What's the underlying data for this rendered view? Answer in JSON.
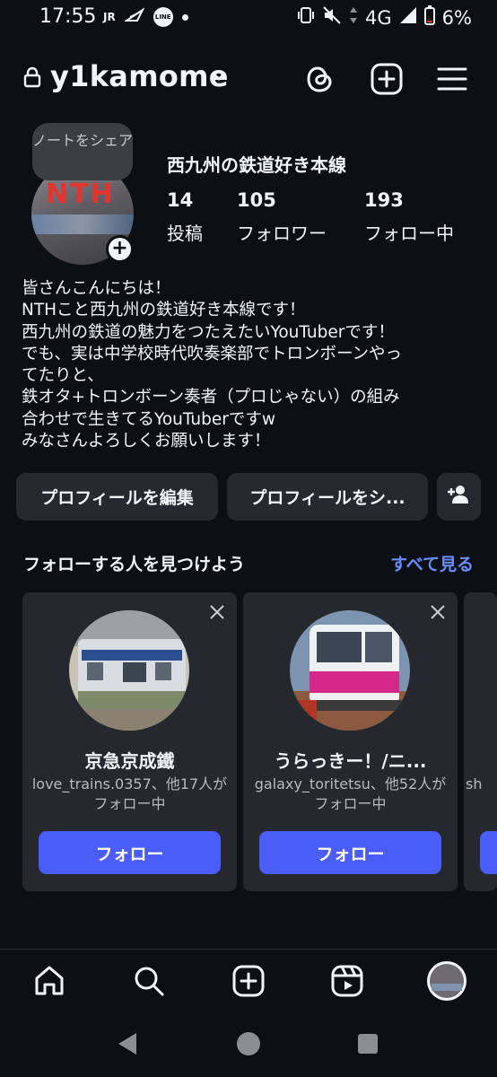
{
  "status_bar": {
    "time": "17:55",
    "jr_label": "JR",
    "line_label": "LINE",
    "network": "4G",
    "battery": "6%"
  },
  "header": {
    "username": "y1kamome",
    "icons": [
      "lock-icon",
      "chevron-down-icon",
      "threads-icon",
      "create-post-icon",
      "menu-icon"
    ]
  },
  "profile": {
    "note_prompt": "ノートをシェア",
    "avatar_text": "NTH",
    "display_name": "西九州の鉄道好き本線",
    "stats": [
      {
        "value": "14",
        "label": "投稿"
      },
      {
        "value": "105",
        "label": "フォロワー"
      },
      {
        "value": "193",
        "label": "フォロー中"
      }
    ],
    "bio_lines": [
      "皆さんこんにちは！",
      "NTHこと西九州の鉄道好き本線です！",
      "西九州の鉄道の魅力をつたえたいYouTuberです！",
      "でも、実は中学校時代吹奏楽部でトロンボーンやっ",
      "てたりと、",
      "鉄オタ+トロンボーン奏者（プロじゃない）の組み",
      "合わせで生きてるYouTuberですw",
      "みなさんよろしくお願いします！"
    ]
  },
  "actions": {
    "edit_profile": "プロフィールを編集",
    "share_profile": "プロフィールをシ...",
    "discover_icon": "add-person-icon"
  },
  "suggestions": {
    "title": "フォローする人を見つけよう",
    "see_all": "すべて見る",
    "cards": [
      {
        "name": "京急京成鐵",
        "subtitle": "love_trains.0357、他17人がフォロー中",
        "button": "フォロー"
      },
      {
        "name": "うらっきー！/ニ...",
        "subtitle": "galaxy_toritetsu、他52人がフォロー中",
        "button": "フォロー"
      },
      {
        "name": "",
        "subtitle": "sh",
        "button": ""
      }
    ]
  },
  "bottom_nav": {
    "items": [
      "home-icon",
      "search-icon",
      "create-icon",
      "reels-icon",
      "profile-avatar-icon"
    ],
    "avatar_text": "NTH"
  },
  "system_nav": [
    "back-icon",
    "home-circle-icon",
    "recents-square-icon"
  ],
  "colors": {
    "background": "#0c1015",
    "surface": "#25282e",
    "button": "#26292f",
    "accent": "#4a5df9",
    "link": "#6b8dfd"
  }
}
